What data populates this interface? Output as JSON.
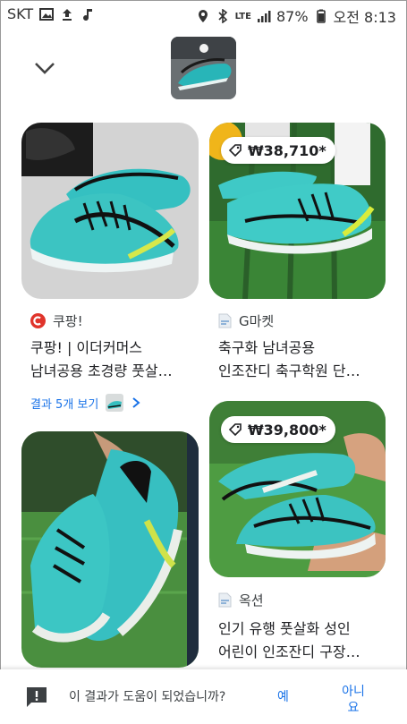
{
  "status_bar": {
    "carrier": "SKT",
    "network": "LTE",
    "battery": "87%",
    "time": "오전 8:13",
    "left_icons": [
      "image-icon",
      "upload-icon",
      "music-note-icon"
    ],
    "right_icons": [
      "location-icon",
      "bluetooth-icon",
      "signal-icon",
      "battery-icon"
    ]
  },
  "results": [
    {
      "source": "쿠팡!",
      "source_icon": "coupang-logo-icon",
      "title_line1": "쿠팡! | 이더커머스",
      "title_line2": "남녀공용 초경량 풋살…",
      "more_label": "결과 5개 보기"
    },
    {
      "price": "₩38,710*",
      "source": "G마켓",
      "source_icon": "gmarket-favicon-icon",
      "title_line1": "축구화 남녀공용",
      "title_line2": "인조잔디 축구학원 단…"
    },
    {
      "price": "₩39,800*",
      "source": "옥션",
      "source_icon": "auction-favicon-icon",
      "title_line1": "인기 유행 풋살화 성인",
      "title_line2": "어린이 인조잔디 구장…"
    }
  ],
  "feedback": {
    "question": "이 결과가 도움이 되었습니까?",
    "yes": "예",
    "no_line1": "아니",
    "no_line2": "요"
  }
}
